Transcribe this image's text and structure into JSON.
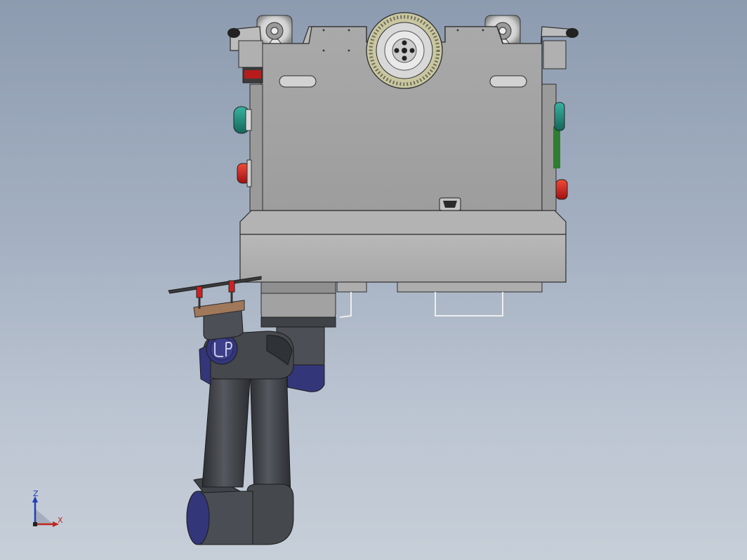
{
  "viewport": {
    "background_top": "#8d9bb0",
    "background_bottom": "#c6ced8"
  },
  "model": {
    "robot_base": {
      "body_color": "#a6a6a6",
      "button_green": "#1d8a7a",
      "button_red": "#d61e1e",
      "gear_color": "#c8c6a0"
    },
    "robot_arm": {
      "link_color": "#3f4247",
      "joint_cap_color": "#34367a",
      "logo_text": "UR"
    }
  },
  "triad": {
    "z_label": "Z",
    "x_label": "X",
    "z_color": "#1f3fb8",
    "x_color": "#c0261f"
  }
}
